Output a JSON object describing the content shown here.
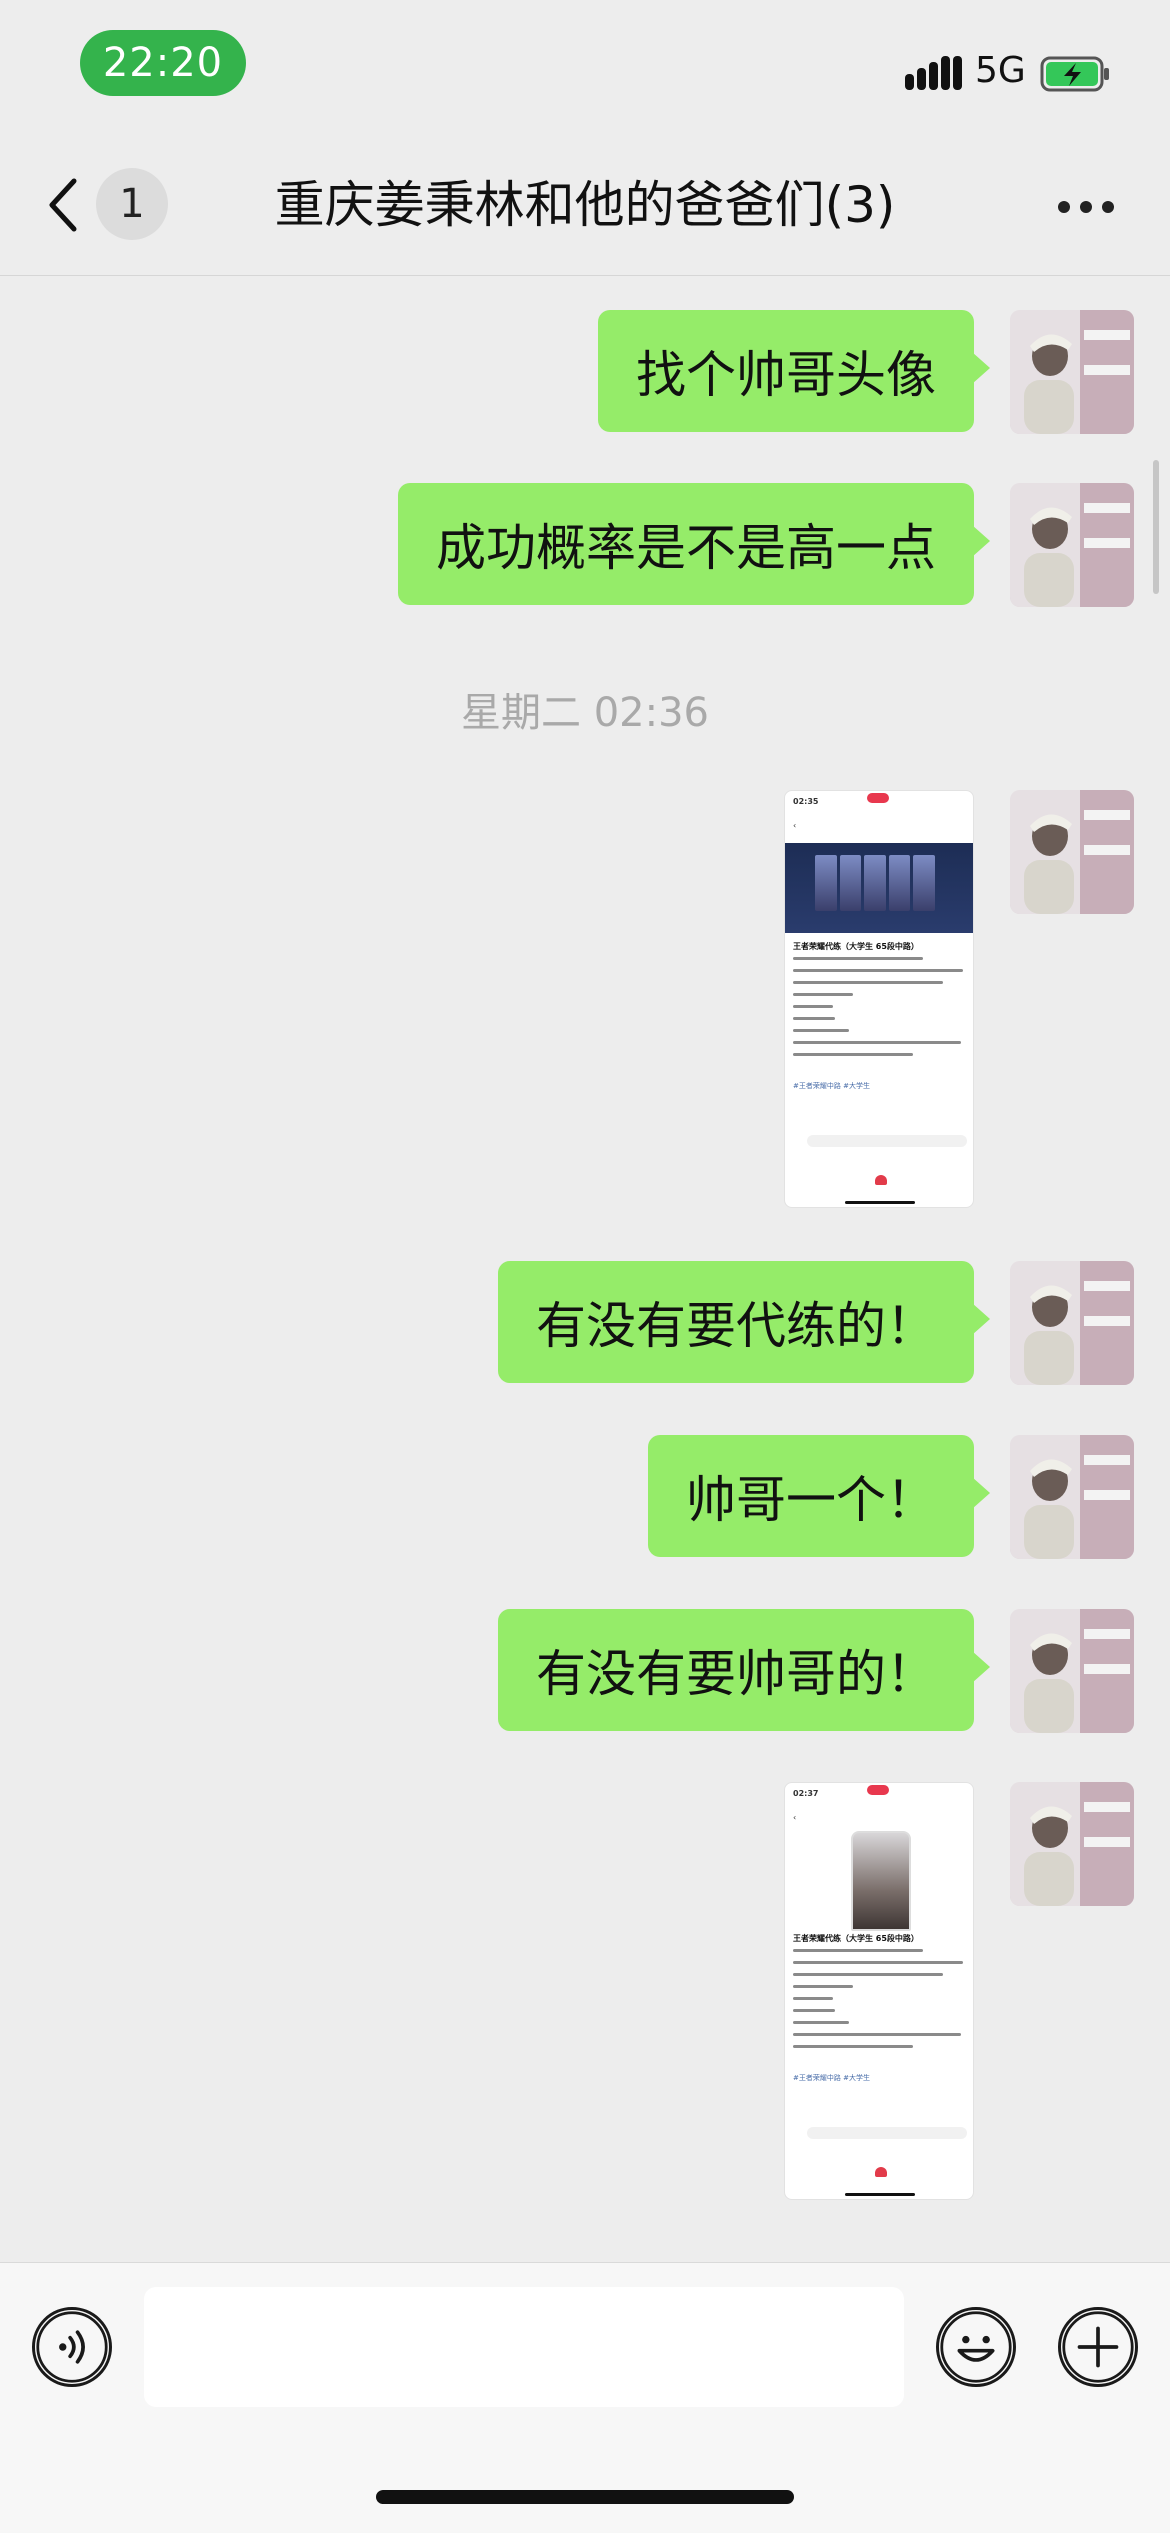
{
  "status_bar": {
    "time": "22:20",
    "network": "5G",
    "time_pill_color": "#34B34C",
    "battery_charging": true
  },
  "header": {
    "unread_count": "1",
    "title": "重庆姜秉林和他的爸爸们(3)",
    "back_icon": "chevron-left-icon",
    "more_icon": "more-horizontal-icon"
  },
  "messages": [
    {
      "type": "text",
      "from": "me",
      "text": "找个帅哥头像"
    },
    {
      "type": "text",
      "from": "me",
      "text": "成功概率是不是高一点"
    },
    {
      "type": "timestamp",
      "text": "星期二 02:36"
    },
    {
      "type": "image",
      "from": "me",
      "description": "screenshot-post-1"
    },
    {
      "type": "text",
      "from": "me",
      "text": "有没有要代练的！"
    },
    {
      "type": "text",
      "from": "me",
      "text": "帅哥一个！"
    },
    {
      "type": "text",
      "from": "me",
      "text": "有没有要帅哥的！"
    },
    {
      "type": "image",
      "from": "me",
      "description": "screenshot-post-2"
    }
  ],
  "thumb1": {
    "time": "02:35",
    "title": "王者荣耀代练（大学生 65段中路）",
    "tag": "#王者荣耀中路  #大学生"
  },
  "thumb2": {
    "time": "02:37",
    "title": "王者荣耀代练（大学生 65段中路）",
    "tag": "#王者荣耀中路  #大学生"
  },
  "input_bar": {
    "voice_icon": "voice-icon",
    "emoji_icon": "emoji-icon",
    "plus_icon": "plus-icon",
    "value": ""
  },
  "colors": {
    "bubble_green": "#95EC69",
    "background": "#EDEDED"
  }
}
